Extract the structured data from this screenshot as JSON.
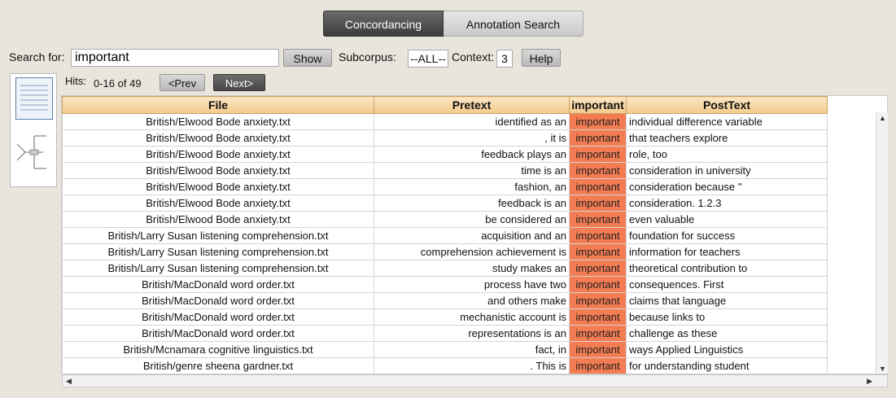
{
  "tabs": [
    {
      "label": "Concordancing"
    },
    {
      "label": "Annotation Search"
    }
  ],
  "search": {
    "label": "Search for:",
    "value": "important",
    "show_label": "Show",
    "subcorpus_label": "Subcorpus:",
    "subcorpus_value": "--ALL--",
    "context_label": "Context:",
    "context_value": "3",
    "help_label": "Help"
  },
  "hits": {
    "label": "Hits:",
    "range": "0-16 of 49",
    "prev_label": "<Prev",
    "next_label": "Next>"
  },
  "table": {
    "columns": [
      "File",
      "Pretext",
      "important",
      "PostText"
    ],
    "rows": [
      {
        "file": "British/Elwood Bode anxiety.txt",
        "pre": "identified as an",
        "kw": "important",
        "post": "individual difference variable"
      },
      {
        "file": "British/Elwood Bode anxiety.txt",
        "pre": ", it is",
        "kw": "important",
        "post": "that teachers explore"
      },
      {
        "file": "British/Elwood Bode anxiety.txt",
        "pre": "feedback plays an",
        "kw": "important",
        "post": "role, too"
      },
      {
        "file": "British/Elwood Bode anxiety.txt",
        "pre": "time is an",
        "kw": "important",
        "post": "consideration in university"
      },
      {
        "file": "British/Elwood Bode anxiety.txt",
        "pre": "fashion, an",
        "kw": "important",
        "post": "consideration because \""
      },
      {
        "file": "British/Elwood Bode anxiety.txt",
        "pre": "feedback is an",
        "kw": "important",
        "post": "consideration. 1.2.3"
      },
      {
        "file": "British/Elwood Bode anxiety.txt",
        "pre": "be considered an",
        "kw": "important",
        "post": "even valuable"
      },
      {
        "file": "British/Larry Susan listening comprehension.txt",
        "pre": "acquisition and an",
        "kw": "important",
        "post": "foundation for success"
      },
      {
        "file": "British/Larry Susan listening comprehension.txt",
        "pre": "comprehension achievement is",
        "kw": "important",
        "post": "information for teachers"
      },
      {
        "file": "British/Larry Susan listening comprehension.txt",
        "pre": "study makes an",
        "kw": "important",
        "post": "theoretical contribution to"
      },
      {
        "file": "British/MacDonald word order.txt",
        "pre": "process have two",
        "kw": "important",
        "post": "consequences. First"
      },
      {
        "file": "British/MacDonald word order.txt",
        "pre": "and others make",
        "kw": "important",
        "post": "claims that language"
      },
      {
        "file": "British/MacDonald word order.txt",
        "pre": "mechanistic account is",
        "kw": "important",
        "post": "because links to"
      },
      {
        "file": "British/MacDonald word order.txt",
        "pre": "representations is an",
        "kw": "important",
        "post": "challenge as these"
      },
      {
        "file": "British/Mcnamara cognitive linguistics.txt",
        "pre": "fact, in",
        "kw": "important",
        "post": "ways Applied Linguistics"
      },
      {
        "file": "British/genre sheena gardner.txt",
        "pre": ". This is",
        "kw": "important",
        "post": "for understanding student"
      }
    ]
  },
  "colors": {
    "keyword_bg": "#f47c52",
    "header_bg": "#f3c98a",
    "active_tab": "#4a4a4a"
  }
}
